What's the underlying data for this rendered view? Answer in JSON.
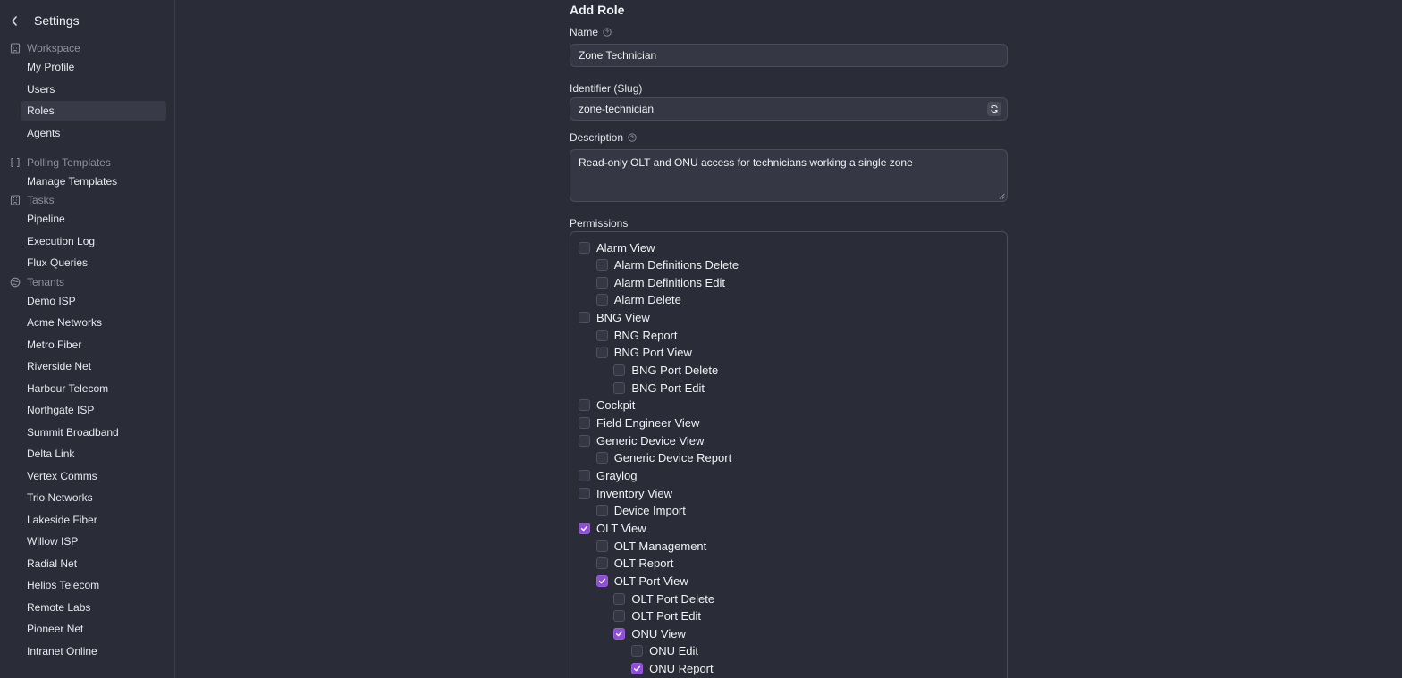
{
  "sidebar": {
    "title": "Settings",
    "sections": [
      {
        "label": "Workspace",
        "icon": "building-icon"
      },
      {
        "label": "Polling Templates",
        "icon": "brackets-icon"
      },
      {
        "label": "Tasks",
        "icon": "building-icon"
      },
      {
        "label": "Tenants",
        "icon": "globe-icon"
      }
    ],
    "items": [
      {
        "label": "My Profile"
      },
      {
        "label": "Users"
      },
      {
        "label": "Roles",
        "active": true
      },
      {
        "label": "Agents"
      },
      {
        "label": "Manage Templates"
      },
      {
        "label": "Pipeline"
      },
      {
        "label": "Execution Log"
      },
      {
        "label": "Flux Queries"
      },
      {
        "label": "Demo ISP"
      },
      {
        "label": "Acme Networks"
      },
      {
        "label": "Metro Fiber"
      },
      {
        "label": "Riverside Net"
      },
      {
        "label": "Harbour Telecom"
      },
      {
        "label": "Northgate ISP"
      },
      {
        "label": "Summit Broadband"
      },
      {
        "label": "Delta Link"
      },
      {
        "label": "Vertex Comms"
      },
      {
        "label": "Trio Networks"
      },
      {
        "label": "Lakeside Fiber"
      },
      {
        "label": "Willow ISP"
      },
      {
        "label": "Radial Net"
      },
      {
        "label": "Helios Telecom"
      },
      {
        "label": "Remote Labs"
      },
      {
        "label": "Pioneer Net"
      },
      {
        "label": "Intranet Online"
      }
    ]
  },
  "form": {
    "title": "Add Role",
    "name": {
      "label": "Name",
      "value": "Zone Technician"
    },
    "slug": {
      "label": "Identifier (Slug)",
      "value": "zone-technician"
    },
    "description": {
      "label": "Description",
      "value": "Read-only OLT and ONU access for technicians working a single zone"
    },
    "permissions_label": "Permissions",
    "permissions": [
      {
        "label": "Alarm View",
        "level": 0,
        "checked": false
      },
      {
        "label": "Alarm Definitions Delete",
        "level": 1,
        "checked": false
      },
      {
        "label": "Alarm Definitions Edit",
        "level": 1,
        "checked": false
      },
      {
        "label": "Alarm Delete",
        "level": 1,
        "checked": false
      },
      {
        "label": "BNG View",
        "level": 0,
        "checked": false
      },
      {
        "label": "BNG Report",
        "level": 1,
        "checked": false
      },
      {
        "label": "BNG Port View",
        "level": 1,
        "checked": false
      },
      {
        "label": "BNG Port Delete",
        "level": 2,
        "checked": false
      },
      {
        "label": "BNG Port Edit",
        "level": 2,
        "checked": false
      },
      {
        "label": "Cockpit",
        "level": 0,
        "checked": false
      },
      {
        "label": "Field Engineer View",
        "level": 0,
        "checked": false
      },
      {
        "label": "Generic Device View",
        "level": 0,
        "checked": false
      },
      {
        "label": "Generic Device Report",
        "level": 1,
        "checked": false
      },
      {
        "label": "Graylog",
        "level": 0,
        "checked": false
      },
      {
        "label": "Inventory View",
        "level": 0,
        "checked": false
      },
      {
        "label": "Device Import",
        "level": 1,
        "checked": false
      },
      {
        "label": "OLT View",
        "level": 0,
        "checked": true
      },
      {
        "label": "OLT Management",
        "level": 1,
        "checked": false
      },
      {
        "label": "OLT Report",
        "level": 1,
        "checked": false
      },
      {
        "label": "OLT Port View",
        "level": 1,
        "checked": true
      },
      {
        "label": "OLT Port Delete",
        "level": 2,
        "checked": false
      },
      {
        "label": "OLT Port Edit",
        "level": 2,
        "checked": false
      },
      {
        "label": "ONU View",
        "level": 2,
        "checked": true
      },
      {
        "label": "ONU Edit",
        "level": 3,
        "checked": false
      },
      {
        "label": "ONU Report",
        "level": 3,
        "checked": true
      }
    ]
  },
  "colors": {
    "background": "#2a2c38",
    "accent": "#8e4fd6",
    "input_bg": "#353744",
    "border": "#4a4c59"
  }
}
